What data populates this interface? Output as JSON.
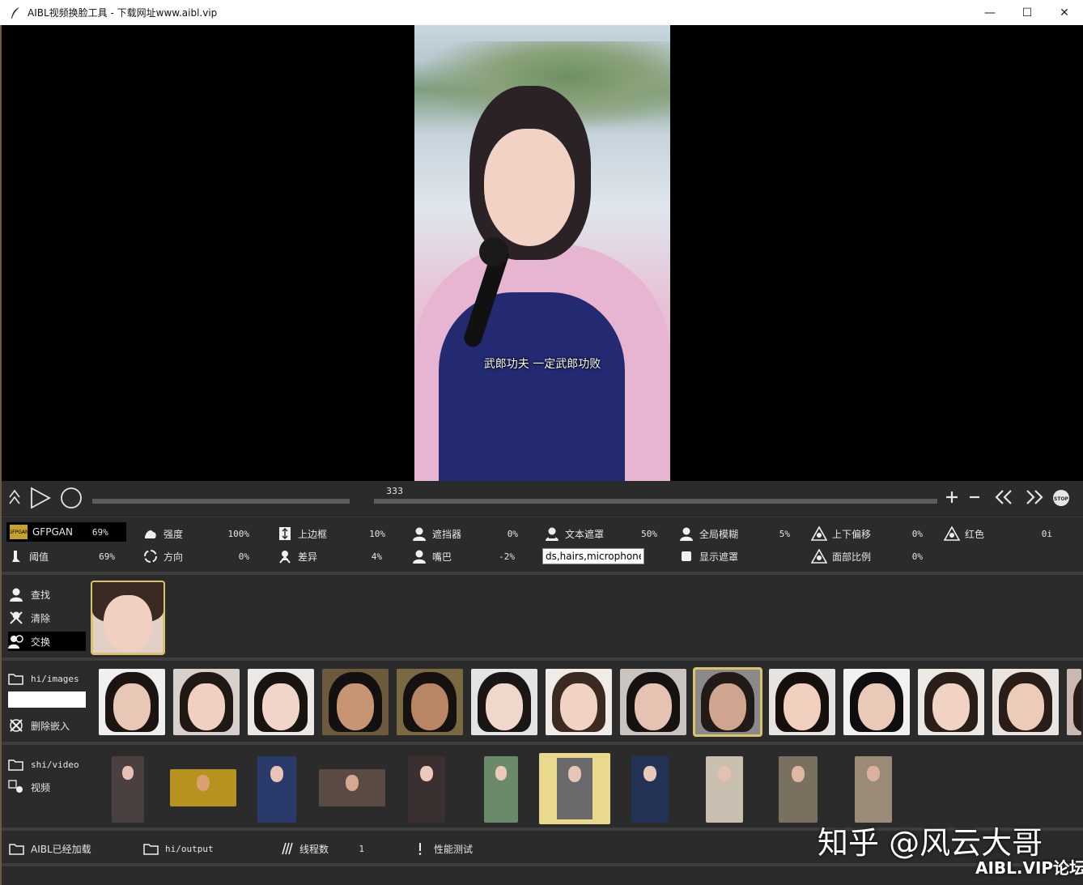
{
  "window": {
    "title": "AIBL视频换脸工具 - 下载网址www.aibl.vip",
    "minimize": "—",
    "maximize": "☐",
    "close": "✕"
  },
  "viewer": {
    "subtitle": "武郎功夫 一定武郎功败"
  },
  "playback": {
    "frame": "333",
    "progress_fraction": 0.333,
    "icons": [
      "collapse-icon",
      "play-icon",
      "record-icon",
      "plus-icon",
      "minus-icon",
      "rewind-icon",
      "fast-forward-icon",
      "stop-icon"
    ],
    "stop_label": "STOP"
  },
  "params": {
    "gfpgan": {
      "label": "GFPGAN",
      "value": "69%",
      "logo_text": "GFPGAN"
    },
    "threshold": {
      "label": "阈值",
      "value": "69%"
    },
    "strength": {
      "label": "强度",
      "value": "100%"
    },
    "direction": {
      "label": "方向",
      "value": "0%"
    },
    "top_border": {
      "label": "上边框",
      "value": "10%"
    },
    "difference": {
      "label": "差异",
      "value": "4%"
    },
    "occluder": {
      "label": "遮挡器",
      "value": "0%"
    },
    "mouth": {
      "label": "嘴巴",
      "value": "-2%"
    },
    "text_mask": {
      "label": "文本遮罩",
      "value": "50%"
    },
    "text_mask_input": "ds,hairs,microphone",
    "global_blur": {
      "label": "全局模糊",
      "value": "5%"
    },
    "show_mask": {
      "label": "显示遮罩"
    },
    "vertical_offset": {
      "label": "上下偏移",
      "value": "0%"
    },
    "face_scale": {
      "label": "面部比例",
      "value": "0%"
    },
    "red": {
      "label": "红色",
      "value": "0i"
    }
  },
  "faces_panel": {
    "find": "查找",
    "clear": "清除",
    "swap": "交换"
  },
  "images_panel": {
    "folder": "hi/images",
    "delete_embedding": "删除嵌入",
    "selected_index": 8
  },
  "video_panel": {
    "folder": "shi/video",
    "video": "视频",
    "selected_index": 6
  },
  "bottom": {
    "model_loaded": "AIBL已经加载",
    "output_folder": "hi/output",
    "threads_label": "线程数",
    "threads_value": "1",
    "benchmark": "性能测试"
  },
  "watermark": {
    "line1": "知乎 @风云大哥",
    "line2": "AIBL.VIP论坛"
  }
}
